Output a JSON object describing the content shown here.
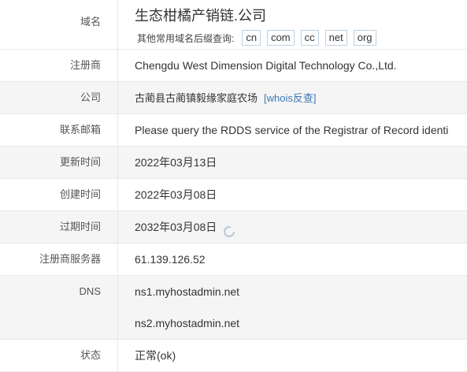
{
  "domain": {
    "label": "域名",
    "name": "生态柑橘产销链.公司",
    "suffix_hint": "其他常用域名后缀查询:",
    "suffixes": [
      "cn",
      "com",
      "cc",
      "net",
      "org"
    ]
  },
  "registrar": {
    "label": "注册商",
    "value": "Chengdu West Dimension Digital Technology Co.,Ltd."
  },
  "company": {
    "label": "公司",
    "value": "古蔺县古蔺镇毅缘家庭农场",
    "whois_link": "[whois反查]"
  },
  "email": {
    "label": "联系邮箱",
    "value": "Please query the RDDS service of the Registrar of Record identi"
  },
  "updated": {
    "label": "更新时间",
    "value": "2022年03月13日"
  },
  "created": {
    "label": "创建时间",
    "value": "2022年03月08日"
  },
  "expires": {
    "label": "过期时间",
    "value": "2032年03月08日"
  },
  "whois_server": {
    "label": "注册商服务器",
    "value": "61.139.126.52"
  },
  "dns": {
    "label": "DNS",
    "servers": [
      "ns1.myhostadmin.net",
      "ns2.myhostadmin.net"
    ]
  },
  "status": {
    "label": "状态",
    "value": "正常(ok)"
  },
  "colors": {
    "link": "#3a78b8",
    "alt_row": "#f5f5f5",
    "chip_border": "#bcd0e2"
  }
}
